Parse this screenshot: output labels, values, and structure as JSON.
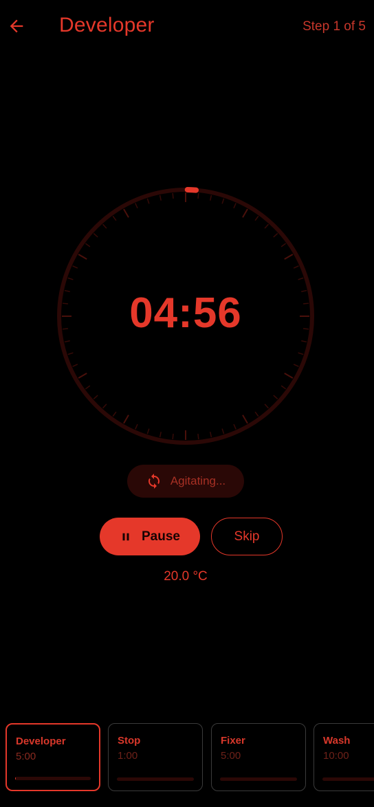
{
  "header": {
    "title": "Developer",
    "step": "Step 1 of 5",
    "back_icon": "arrow-left-icon"
  },
  "timer": {
    "time": "04:56",
    "progress": 0.013
  },
  "agitation": {
    "label": "Agitating...",
    "icon": "sync-icon"
  },
  "controls": {
    "pause_label": "Pause",
    "pause_icon": "pause-icon",
    "skip_label": "Skip"
  },
  "temperature": "20.0 °C",
  "steps": [
    {
      "name": "Developer",
      "duration": "5:00",
      "active": true,
      "progress": 0.01
    },
    {
      "name": "Stop",
      "duration": "1:00",
      "active": false,
      "progress": 0
    },
    {
      "name": "Fixer",
      "duration": "5:00",
      "active": false,
      "progress": 0
    },
    {
      "name": "Wash",
      "duration": "10:00",
      "active": false,
      "progress": 0
    }
  ],
  "colors": {
    "accent": "#e5382a",
    "background": "#000000",
    "track": "#2b0806"
  }
}
